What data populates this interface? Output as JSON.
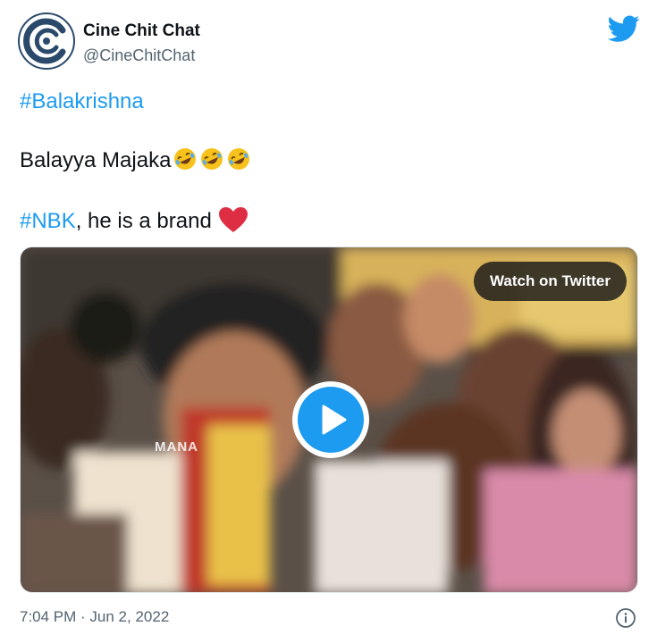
{
  "author": {
    "name": "Cine Chit Chat",
    "handle": "@CineChitChat",
    "avatar_icon": "cine-chit-chat-logo",
    "brand_icon": "twitter-bird-icon"
  },
  "tweet": {
    "hashtag_line": "#Balakrishna",
    "line2_text": "Balayya Majaka",
    "line2_emoji": [
      "rofl-emoji",
      "rofl-emoji",
      "rofl-emoji"
    ],
    "line3_hashtag": "#NBK",
    "line3_text": ", he is a brand",
    "line3_emoji": "red-heart-emoji"
  },
  "media": {
    "watch_label": "Watch on Twitter",
    "watermark": "MANA",
    "play_icon": "play-icon"
  },
  "footer": {
    "timestamp": "7:04 PM · Jun 2, 2022",
    "info_icon": "info-icon"
  },
  "colors": {
    "link": "#1d9bf0",
    "text": "#0f1419",
    "secondary": "#536471",
    "brand_logo": "#2b4a6b"
  }
}
